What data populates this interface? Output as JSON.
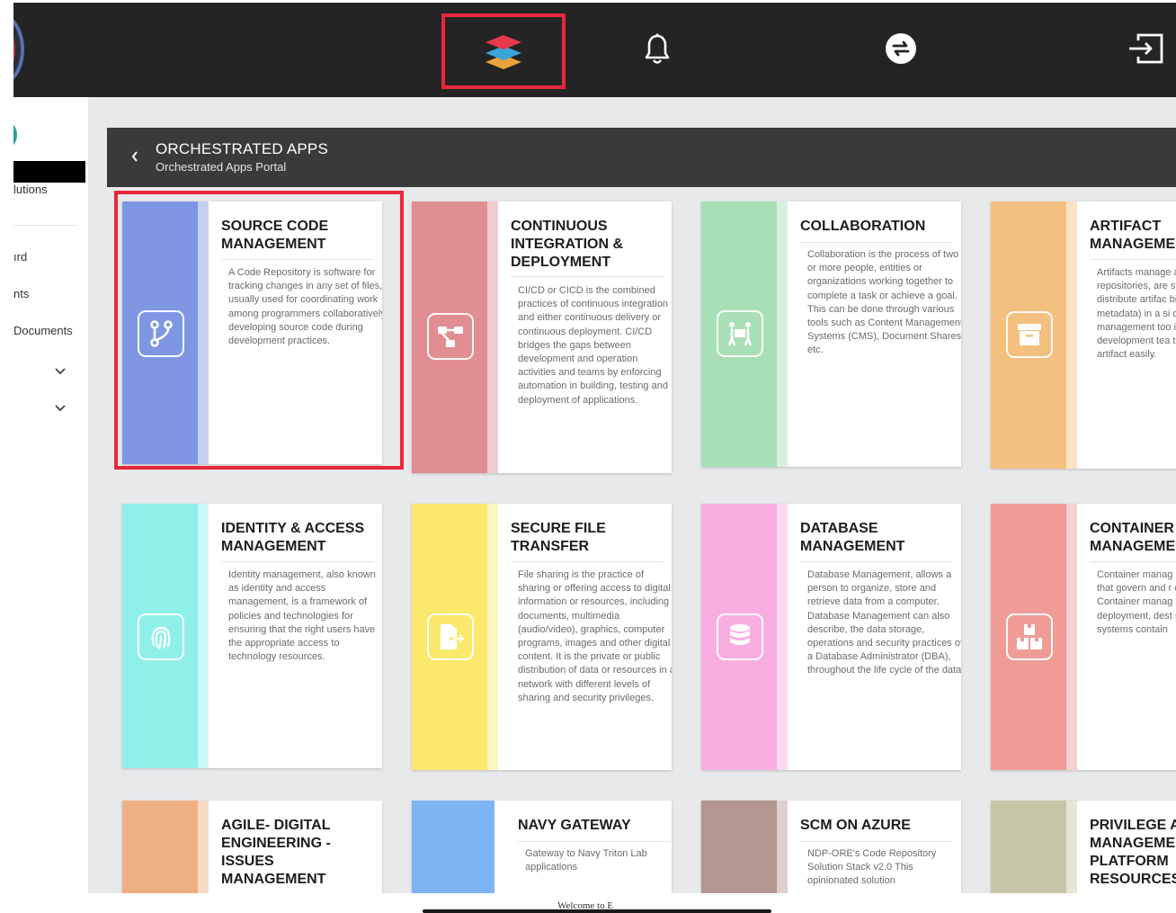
{
  "header": {
    "title": "ORCHESTRATED APPS",
    "subtitle": "Orchestrated Apps Portal"
  },
  "sidebar": {
    "items": [
      {
        "label": "lutions"
      },
      {
        "label": "ırd"
      },
      {
        "label": "nts"
      },
      {
        "label": "Documents"
      }
    ]
  },
  "cards": [
    {
      "title": "SOURCE CODE MANAGEMENT",
      "description": "A Code Repository is software for tracking changes in any set of files, usually used for coordinating work among programmers collaboratively developing source code during development practices.",
      "color": "#7f97e2",
      "icon": "git-branch-icon"
    },
    {
      "title": "CONTINUOUS INTEGRATION & DEPLOYMENT",
      "description": "CI/CD or CICD is the combined practices of continuous integration and either continuous delivery or continuous deployment. CI/CD bridges the gaps between development and operation activities and teams by enforcing automation in building, testing and deployment of applications.",
      "color": "#e08e92",
      "icon": "pipeline-icon"
    },
    {
      "title": "COLLABORATION",
      "description": "Collaboration is the process of two or more people, entities or organizations working together to complete a task or achieve a goal. This can be done through various tools such as Content Management Systems (CMS), Document Shares etc.",
      "color": "#a9dfb6",
      "icon": "people-carry-icon"
    },
    {
      "title": "ARTIFACT MANAGEME",
      "description": "Artifacts manage also known as ar repositories, are store, organize a distribute artifac binary files plus t metadata) in a si centralized locati management too inconsistencies b development tea the right version artifact easily.",
      "color": "#f3c07f",
      "icon": "archive-icon"
    },
    {
      "title": "IDENTITY & ACCESS MANAGEMENT",
      "description": "Identity management, also known as identity and access management, is a framework of policies and technologies for ensuring that the right users have the appropriate access to technology resources.",
      "color": "#8ff0ea",
      "icon": "fingerprint-icon"
    },
    {
      "title": "SECURE FILE TRANSFER",
      "description": "File sharing is the practice of sharing or offering access to digital information or resources, including documents, multimedia (audio/video), graphics, computer programs, images and other digital content. It is the private or public distribution of data or resources in a network with different levels of sharing and security privileges.",
      "color": "#fbe96e",
      "icon": "file-export-icon"
    },
    {
      "title": "DATABASE MANAGEMENT",
      "description": "Database Management, allows a person to organize, store and retrieve data from a computer. Database Management can also describe, the data storage, operations and security practices of a Database Administrator (DBA), throughout the life cycle of the data.",
      "color": "#f9aee2",
      "icon": "database-icon"
    },
    {
      "title": "CONTAINER MANAGEME",
      "description": "Container manag refers to a set of that govern and r containerization Container manag tools automate t deployment, dest scaling of applica systems contain",
      "color": "#ef9c97",
      "icon": "boxes-icon"
    },
    {
      "title": "AGILE- DIGITAL ENGINEERING - ISSUES MANAGEMENT",
      "description": "",
      "color": "#eeb083",
      "icon": ""
    },
    {
      "title": "NAVY GATEWAY",
      "description": "Gateway to Navy Triton Lab applications",
      "color": "#7fb4f2",
      "icon": ""
    },
    {
      "title": "SCM ON AZURE",
      "description": "NDP-ORE's Code Repository Solution Stack v2.0 This opinionated solution",
      "color": "#b49691",
      "icon": ""
    },
    {
      "title": "PRIVILEGE A MANAGEME PLATFORM RESOURCES",
      "description": "",
      "color": "#c7c6a7",
      "icon": ""
    }
  ],
  "footer": {
    "welcome": "Welcome to E"
  },
  "topbar": {
    "icons": [
      "apps-stack-icon",
      "bell-icon",
      "switch-arrows-icon",
      "logout-icon"
    ],
    "highlight_color": "#e8283a"
  }
}
